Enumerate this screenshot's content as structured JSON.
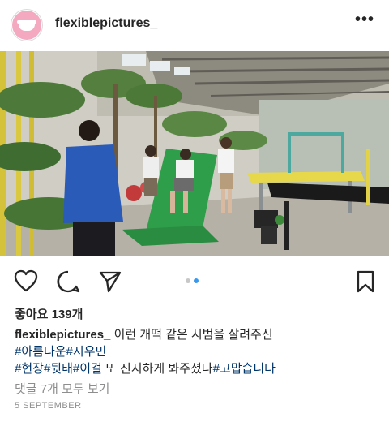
{
  "post": {
    "username": "flexiblepictures_",
    "more_icon": "more-horizontal-icon",
    "likes": "좋아요 139개",
    "caption": {
      "username": "flexiblepictures_",
      "line1": "이런 개떡 같은 시범을 살려주신",
      "line2_tags": [
        "#아름다운",
        "#시우민"
      ],
      "line3_tags": [
        "#현장",
        "#뒷태",
        "#이걸"
      ],
      "line3_text": " 또 진지하게 봐주셨다",
      "line3_end_tag": "#고맙습니다"
    },
    "comments_link": "댓글 7개 모두 보기",
    "date": "5 SEPTEMBER",
    "carousel": {
      "count": 2,
      "active": 2
    }
  },
  "icons": {
    "like": "heart-icon",
    "comment": "comment-icon",
    "share": "send-icon",
    "save": "bookmark-icon"
  },
  "colors": {
    "text": "#262626",
    "muted": "#8e8e8e",
    "hashtag": "#003569",
    "active_dot": "#3897f0",
    "inactive_dot": "#c7c7c7",
    "avatar_bg": "#f4a9c0"
  }
}
